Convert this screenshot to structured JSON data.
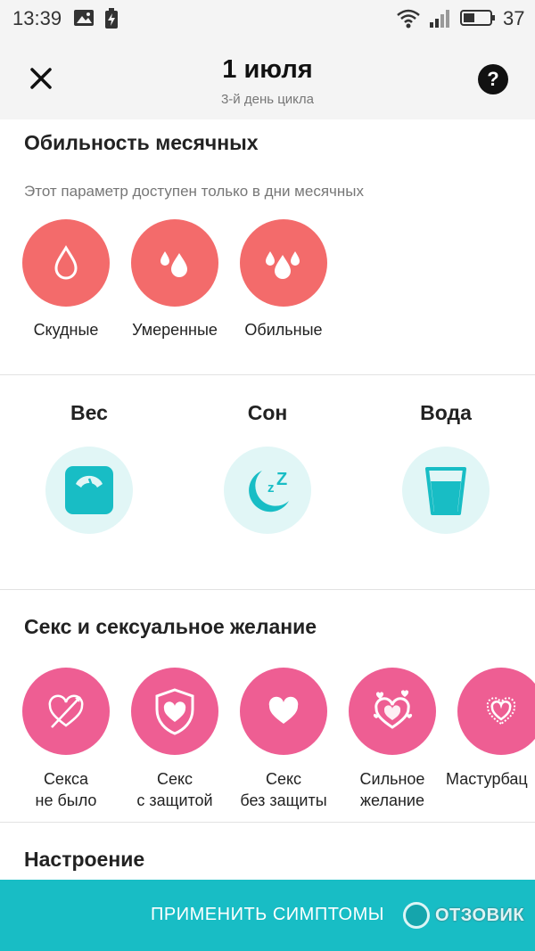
{
  "status_bar": {
    "time": "13:39",
    "battery": "37"
  },
  "header": {
    "title": "1 июля",
    "subtitle": "3-й день цикла",
    "help_label": "?"
  },
  "flow": {
    "title": "Обильность месячных",
    "note": "Этот параметр доступен только в дни месячных",
    "items": [
      {
        "label": "Скудные",
        "icon": "drop-icon"
      },
      {
        "label": "Умеренные",
        "icon": "two-drops-icon"
      },
      {
        "label": "Обильные",
        "icon": "three-drops-icon"
      }
    ]
  },
  "trackers": [
    {
      "title": "Вес",
      "icon": "scale-icon"
    },
    {
      "title": "Сон",
      "icon": "moon-sleep-icon"
    },
    {
      "title": "Вода",
      "icon": "glass-icon"
    }
  ],
  "sex": {
    "title": "Секс и сексуальное желание",
    "items": [
      {
        "line1": "Секса",
        "line2": "не было",
        "icon": "crossed-heart-icon"
      },
      {
        "line1": "Секс",
        "line2": "с защитой",
        "icon": "shield-heart-icon"
      },
      {
        "line1": "Секс",
        "line2": "без защиты",
        "icon": "heart-icon"
      },
      {
        "line1": "Сильное",
        "line2": "желание",
        "icon": "hearts-icon"
      },
      {
        "line1": "Мастурбац",
        "line2": "",
        "icon": "sparkle-heart-icon"
      }
    ]
  },
  "mood": {
    "title": "Настроение"
  },
  "apply_button": {
    "label": "ПРИМЕНИТЬ СИМПТОМЫ"
  },
  "watermark": {
    "text": "ОТЗОВИК"
  },
  "colors": {
    "coral": "#f36b6b",
    "pink": "#ee5e93",
    "teal": "#18bdc5",
    "mint": "#e1f6f6"
  }
}
